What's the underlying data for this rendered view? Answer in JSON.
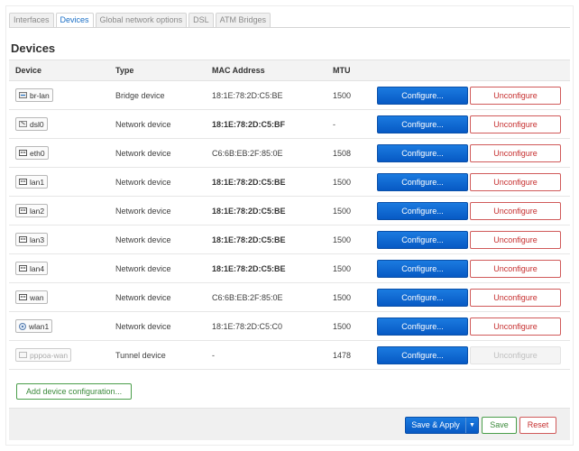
{
  "tabs": [
    {
      "label": "Interfaces",
      "active": false
    },
    {
      "label": "Devices",
      "active": true
    },
    {
      "label": "Global network options",
      "active": false
    },
    {
      "label": "DSL",
      "active": false
    },
    {
      "label": "ATM Bridges",
      "active": false
    }
  ],
  "page_title": "Devices",
  "table": {
    "headers": {
      "device": "Device",
      "type": "Type",
      "mac": "MAC Address",
      "mtu": "MTU"
    },
    "rows": [
      {
        "device": "br-lan",
        "icon": "bridge-icon",
        "type": "Bridge device",
        "mac": "18:1E:78:2D:C5:BE",
        "mtu": "1500"
      },
      {
        "device": "dsl0",
        "icon": "dsl-icon",
        "type": "Network device",
        "mac": "18:1E:78:2D:C5:BF",
        "mtu": "-"
      },
      {
        "device": "eth0",
        "icon": "ethernet-port-icon",
        "type": "Network device",
        "mac": "C6:6B:EB:2F:85:0E",
        "mtu": "1508"
      },
      {
        "device": "lan1",
        "icon": "ethernet-port-icon",
        "type": "Network device",
        "mac": "18:1E:78:2D:C5:BE",
        "mtu": "1500"
      },
      {
        "device": "lan2",
        "icon": "ethernet-port-icon",
        "type": "Network device",
        "mac": "18:1E:78:2D:C5:BE",
        "mtu": "1500"
      },
      {
        "device": "lan3",
        "icon": "ethernet-port-icon",
        "type": "Network device",
        "mac": "18:1E:78:2D:C5:BE",
        "mtu": "1500"
      },
      {
        "device": "lan4",
        "icon": "ethernet-port-icon",
        "type": "Network device",
        "mac": "18:1E:78:2D:C5:BE",
        "mtu": "1500"
      },
      {
        "device": "wan",
        "icon": "ethernet-port-icon",
        "type": "Network device",
        "mac": "C6:6B:EB:2F:85:0E",
        "mtu": "1500"
      },
      {
        "device": "wlan1",
        "icon": "wifi-icon",
        "type": "Network device",
        "mac": "18:1E:78:2D:C5:C0",
        "mtu": "1500"
      },
      {
        "device": "pppoa-wan",
        "icon": "tunnel-icon",
        "type": "Tunnel device",
        "mac": "-",
        "mtu": "1478"
      }
    ],
    "configure_label": "Configure...",
    "unconfigure_label": "Unconfigure"
  },
  "add_device_label": "Add device configuration...",
  "footer": {
    "save_apply_label": "Save & Apply",
    "save_label": "Save",
    "reset_label": "Reset"
  },
  "colors": {
    "primary": "#0759c4",
    "positive": "#3b8a3b",
    "negative": "#c62f2f",
    "active_tab": "#1a6fc6"
  }
}
